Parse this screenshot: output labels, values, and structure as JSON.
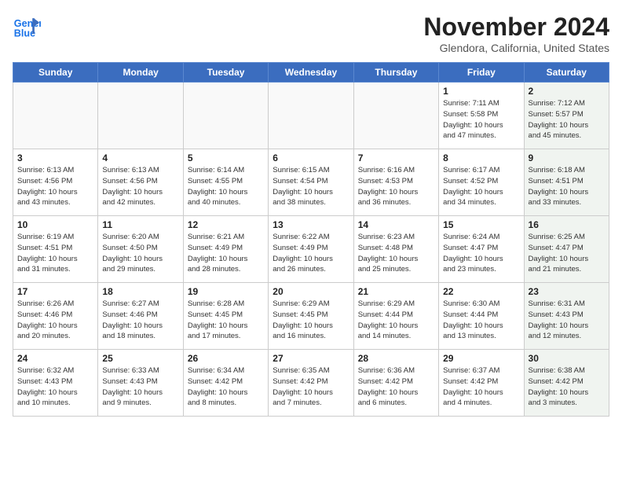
{
  "header": {
    "logo_line1": "General",
    "logo_line2": "Blue",
    "month": "November 2024",
    "location": "Glendora, California, United States"
  },
  "weekdays": [
    "Sunday",
    "Monday",
    "Tuesday",
    "Wednesday",
    "Thursday",
    "Friday",
    "Saturday"
  ],
  "weeks": [
    [
      {
        "day": "",
        "info": ""
      },
      {
        "day": "",
        "info": ""
      },
      {
        "day": "",
        "info": ""
      },
      {
        "day": "",
        "info": ""
      },
      {
        "day": "",
        "info": ""
      },
      {
        "day": "1",
        "info": "Sunrise: 7:11 AM\nSunset: 5:58 PM\nDaylight: 10 hours\nand 47 minutes."
      },
      {
        "day": "2",
        "info": "Sunrise: 7:12 AM\nSunset: 5:57 PM\nDaylight: 10 hours\nand 45 minutes."
      }
    ],
    [
      {
        "day": "3",
        "info": "Sunrise: 6:13 AM\nSunset: 4:56 PM\nDaylight: 10 hours\nand 43 minutes."
      },
      {
        "day": "4",
        "info": "Sunrise: 6:13 AM\nSunset: 4:56 PM\nDaylight: 10 hours\nand 42 minutes."
      },
      {
        "day": "5",
        "info": "Sunrise: 6:14 AM\nSunset: 4:55 PM\nDaylight: 10 hours\nand 40 minutes."
      },
      {
        "day": "6",
        "info": "Sunrise: 6:15 AM\nSunset: 4:54 PM\nDaylight: 10 hours\nand 38 minutes."
      },
      {
        "day": "7",
        "info": "Sunrise: 6:16 AM\nSunset: 4:53 PM\nDaylight: 10 hours\nand 36 minutes."
      },
      {
        "day": "8",
        "info": "Sunrise: 6:17 AM\nSunset: 4:52 PM\nDaylight: 10 hours\nand 34 minutes."
      },
      {
        "day": "9",
        "info": "Sunrise: 6:18 AM\nSunset: 4:51 PM\nDaylight: 10 hours\nand 33 minutes."
      }
    ],
    [
      {
        "day": "10",
        "info": "Sunrise: 6:19 AM\nSunset: 4:51 PM\nDaylight: 10 hours\nand 31 minutes."
      },
      {
        "day": "11",
        "info": "Sunrise: 6:20 AM\nSunset: 4:50 PM\nDaylight: 10 hours\nand 29 minutes."
      },
      {
        "day": "12",
        "info": "Sunrise: 6:21 AM\nSunset: 4:49 PM\nDaylight: 10 hours\nand 28 minutes."
      },
      {
        "day": "13",
        "info": "Sunrise: 6:22 AM\nSunset: 4:49 PM\nDaylight: 10 hours\nand 26 minutes."
      },
      {
        "day": "14",
        "info": "Sunrise: 6:23 AM\nSunset: 4:48 PM\nDaylight: 10 hours\nand 25 minutes."
      },
      {
        "day": "15",
        "info": "Sunrise: 6:24 AM\nSunset: 4:47 PM\nDaylight: 10 hours\nand 23 minutes."
      },
      {
        "day": "16",
        "info": "Sunrise: 6:25 AM\nSunset: 4:47 PM\nDaylight: 10 hours\nand 21 minutes."
      }
    ],
    [
      {
        "day": "17",
        "info": "Sunrise: 6:26 AM\nSunset: 4:46 PM\nDaylight: 10 hours\nand 20 minutes."
      },
      {
        "day": "18",
        "info": "Sunrise: 6:27 AM\nSunset: 4:46 PM\nDaylight: 10 hours\nand 18 minutes."
      },
      {
        "day": "19",
        "info": "Sunrise: 6:28 AM\nSunset: 4:45 PM\nDaylight: 10 hours\nand 17 minutes."
      },
      {
        "day": "20",
        "info": "Sunrise: 6:29 AM\nSunset: 4:45 PM\nDaylight: 10 hours\nand 16 minutes."
      },
      {
        "day": "21",
        "info": "Sunrise: 6:29 AM\nSunset: 4:44 PM\nDaylight: 10 hours\nand 14 minutes."
      },
      {
        "day": "22",
        "info": "Sunrise: 6:30 AM\nSunset: 4:44 PM\nDaylight: 10 hours\nand 13 minutes."
      },
      {
        "day": "23",
        "info": "Sunrise: 6:31 AM\nSunset: 4:43 PM\nDaylight: 10 hours\nand 12 minutes."
      }
    ],
    [
      {
        "day": "24",
        "info": "Sunrise: 6:32 AM\nSunset: 4:43 PM\nDaylight: 10 hours\nand 10 minutes."
      },
      {
        "day": "25",
        "info": "Sunrise: 6:33 AM\nSunset: 4:43 PM\nDaylight: 10 hours\nand 9 minutes."
      },
      {
        "day": "26",
        "info": "Sunrise: 6:34 AM\nSunset: 4:42 PM\nDaylight: 10 hours\nand 8 minutes."
      },
      {
        "day": "27",
        "info": "Sunrise: 6:35 AM\nSunset: 4:42 PM\nDaylight: 10 hours\nand 7 minutes."
      },
      {
        "day": "28",
        "info": "Sunrise: 6:36 AM\nSunset: 4:42 PM\nDaylight: 10 hours\nand 6 minutes."
      },
      {
        "day": "29",
        "info": "Sunrise: 6:37 AM\nSunset: 4:42 PM\nDaylight: 10 hours\nand 4 minutes."
      },
      {
        "day": "30",
        "info": "Sunrise: 6:38 AM\nSunset: 4:42 PM\nDaylight: 10 hours\nand 3 minutes."
      }
    ]
  ]
}
